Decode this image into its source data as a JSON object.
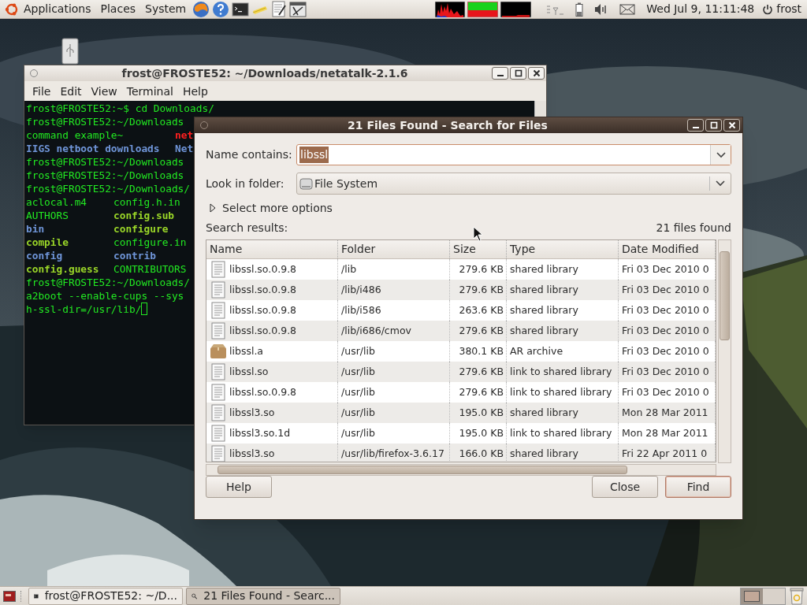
{
  "top_panel": {
    "menus": [
      "Applications",
      "Places",
      "System"
    ],
    "clock": "Wed Jul 9, 11:11:48",
    "user": "frost"
  },
  "terminal": {
    "title": "frost@FROSTE52: ~/Downloads/netatalk-2.1.6",
    "menu": [
      "File",
      "Edit",
      "View",
      "Terminal",
      "Help"
    ],
    "lines": [
      {
        "kind": "single",
        "cursor": false,
        "segments": [
          {
            "text": "frost@FROSTE52:~$ cd Downloads/",
            "kind": "plain"
          }
        ]
      },
      {
        "kind": "single",
        "cursor": false,
        "segments": [
          {
            "text": "frost@FROSTE52:~/Downloads",
            "kind": "plain"
          }
        ]
      },
      {
        "kind": "wide",
        "cursor": false,
        "segments": [
          {
            "text": "command example~",
            "kind": "plain"
          },
          {
            "text": "net",
            "kind": "error"
          }
        ]
      },
      {
        "kind": "wide",
        "cursor": false,
        "segments": [
          {
            "text": "IIGS netboot downloads",
            "kind": "dir"
          },
          {
            "text": "Net",
            "kind": "dir"
          }
        ]
      },
      {
        "kind": "single",
        "cursor": false,
        "segments": [
          {
            "text": "frost@FROSTE52:~/Downloads",
            "kind": "plain"
          }
        ]
      },
      {
        "kind": "single",
        "cursor": false,
        "segments": [
          {
            "text": "frost@FROSTE52:~/Downloads",
            "kind": "plain"
          }
        ]
      },
      {
        "kind": "single",
        "cursor": false,
        "segments": [
          {
            "text": "frost@FROSTE52:~/Downloads/",
            "kind": "plain"
          }
        ]
      },
      {
        "kind": "listing",
        "cursor": false,
        "segments": [
          {
            "text": "aclocal.m4",
            "kind": "plain"
          },
          {
            "text": "config.h.in",
            "kind": "plain"
          }
        ]
      },
      {
        "kind": "listing",
        "cursor": false,
        "segments": [
          {
            "text": "AUTHORS",
            "kind": "plain"
          },
          {
            "text": "config.sub",
            "kind": "exec"
          }
        ]
      },
      {
        "kind": "listing",
        "cursor": false,
        "segments": [
          {
            "text": "bin",
            "kind": "dir"
          },
          {
            "text": "configure",
            "kind": "exec"
          }
        ]
      },
      {
        "kind": "listing",
        "cursor": false,
        "segments": [
          {
            "text": "compile",
            "kind": "exec"
          },
          {
            "text": "configure.in",
            "kind": "plain"
          }
        ]
      },
      {
        "kind": "listing",
        "cursor": false,
        "segments": [
          {
            "text": "config",
            "kind": "dir"
          },
          {
            "text": "contrib",
            "kind": "dir"
          }
        ]
      },
      {
        "kind": "listing",
        "cursor": false,
        "segments": [
          {
            "text": "config.guess",
            "kind": "exec"
          },
          {
            "text": "CONTRIBUTORS",
            "kind": "plain"
          }
        ]
      },
      {
        "kind": "single",
        "cursor": false,
        "segments": [
          {
            "text": "frost@FROSTE52:~/Downloads/",
            "kind": "plain"
          }
        ]
      },
      {
        "kind": "single",
        "cursor": false,
        "segments": [
          {
            "text": "a2boot --enable-cups --sys",
            "kind": "plain"
          }
        ]
      },
      {
        "kind": "single",
        "cursor": true,
        "segments": [
          {
            "text": "h-ssl-dir=/usr/lib/",
            "kind": "plain"
          }
        ]
      }
    ]
  },
  "search_dialog": {
    "title": "21 Files Found - Search for Files",
    "name_label": "Name contains:",
    "name_value": "libssl",
    "name_value_highlighted": true,
    "folder_label": "Look in folder:",
    "folder_value": "File System",
    "more_options": {
      "label": "Select more options",
      "expanded": false
    },
    "results_label": "Search results:",
    "results_count": "21 files found",
    "columns": [
      "Name",
      "Folder",
      "Size",
      "Type",
      "Date Modified"
    ],
    "rows": [
      {
        "kind": "file",
        "cells": [
          "libssl.so.0.9.8",
          "/lib",
          "279.6 KB",
          "shared library",
          "Fri 03 Dec 2010 0"
        ]
      },
      {
        "kind": "file",
        "cells": [
          "libssl.so.0.9.8",
          "/lib/i486",
          "279.6 KB",
          "shared library",
          "Fri 03 Dec 2010 0"
        ]
      },
      {
        "kind": "file",
        "cells": [
          "libssl.so.0.9.8",
          "/lib/i586",
          "263.6 KB",
          "shared library",
          "Fri 03 Dec 2010 0"
        ]
      },
      {
        "kind": "file",
        "cells": [
          "libssl.so.0.9.8",
          "/lib/i686/cmov",
          "279.6 KB",
          "shared library",
          "Fri 03 Dec 2010 0"
        ]
      },
      {
        "kind": "archive",
        "cells": [
          "libssl.a",
          "/usr/lib",
          "380.1 KB",
          "AR archive",
          "Fri 03 Dec 2010 0"
        ]
      },
      {
        "kind": "file",
        "cells": [
          "libssl.so",
          "/usr/lib",
          "279.6 KB",
          "link to shared library",
          "Fri 03 Dec 2010 0"
        ]
      },
      {
        "kind": "file",
        "cells": [
          "libssl.so.0.9.8",
          "/usr/lib",
          "279.6 KB",
          "link to shared library",
          "Fri 03 Dec 2010 0"
        ]
      },
      {
        "kind": "file",
        "cells": [
          "libssl3.so",
          "/usr/lib",
          "195.0 KB",
          "shared library",
          "Mon 28 Mar 2011"
        ]
      },
      {
        "kind": "file",
        "cells": [
          "libssl3.so.1d",
          "/usr/lib",
          "195.0 KB",
          "link to shared library",
          "Mon 28 Mar 2011"
        ]
      },
      {
        "kind": "file",
        "cells": [
          "libssl3.so",
          "/usr/lib/firefox-3.6.17",
          "166.0 KB",
          "shared library",
          "Fri 22 Apr 2011 0"
        ]
      }
    ],
    "buttons": [
      {
        "label": "Help",
        "default": false
      },
      {
        "label": "Close",
        "default": false
      },
      {
        "label": "Find",
        "default": true
      }
    ]
  },
  "taskbar": {
    "tasks": [
      {
        "label": "frost@FROSTE52: ~/D...",
        "kind": "terminal",
        "selected": false
      },
      {
        "label": "21 Files Found - Searc...",
        "kind": "search",
        "selected": true
      }
    ]
  }
}
